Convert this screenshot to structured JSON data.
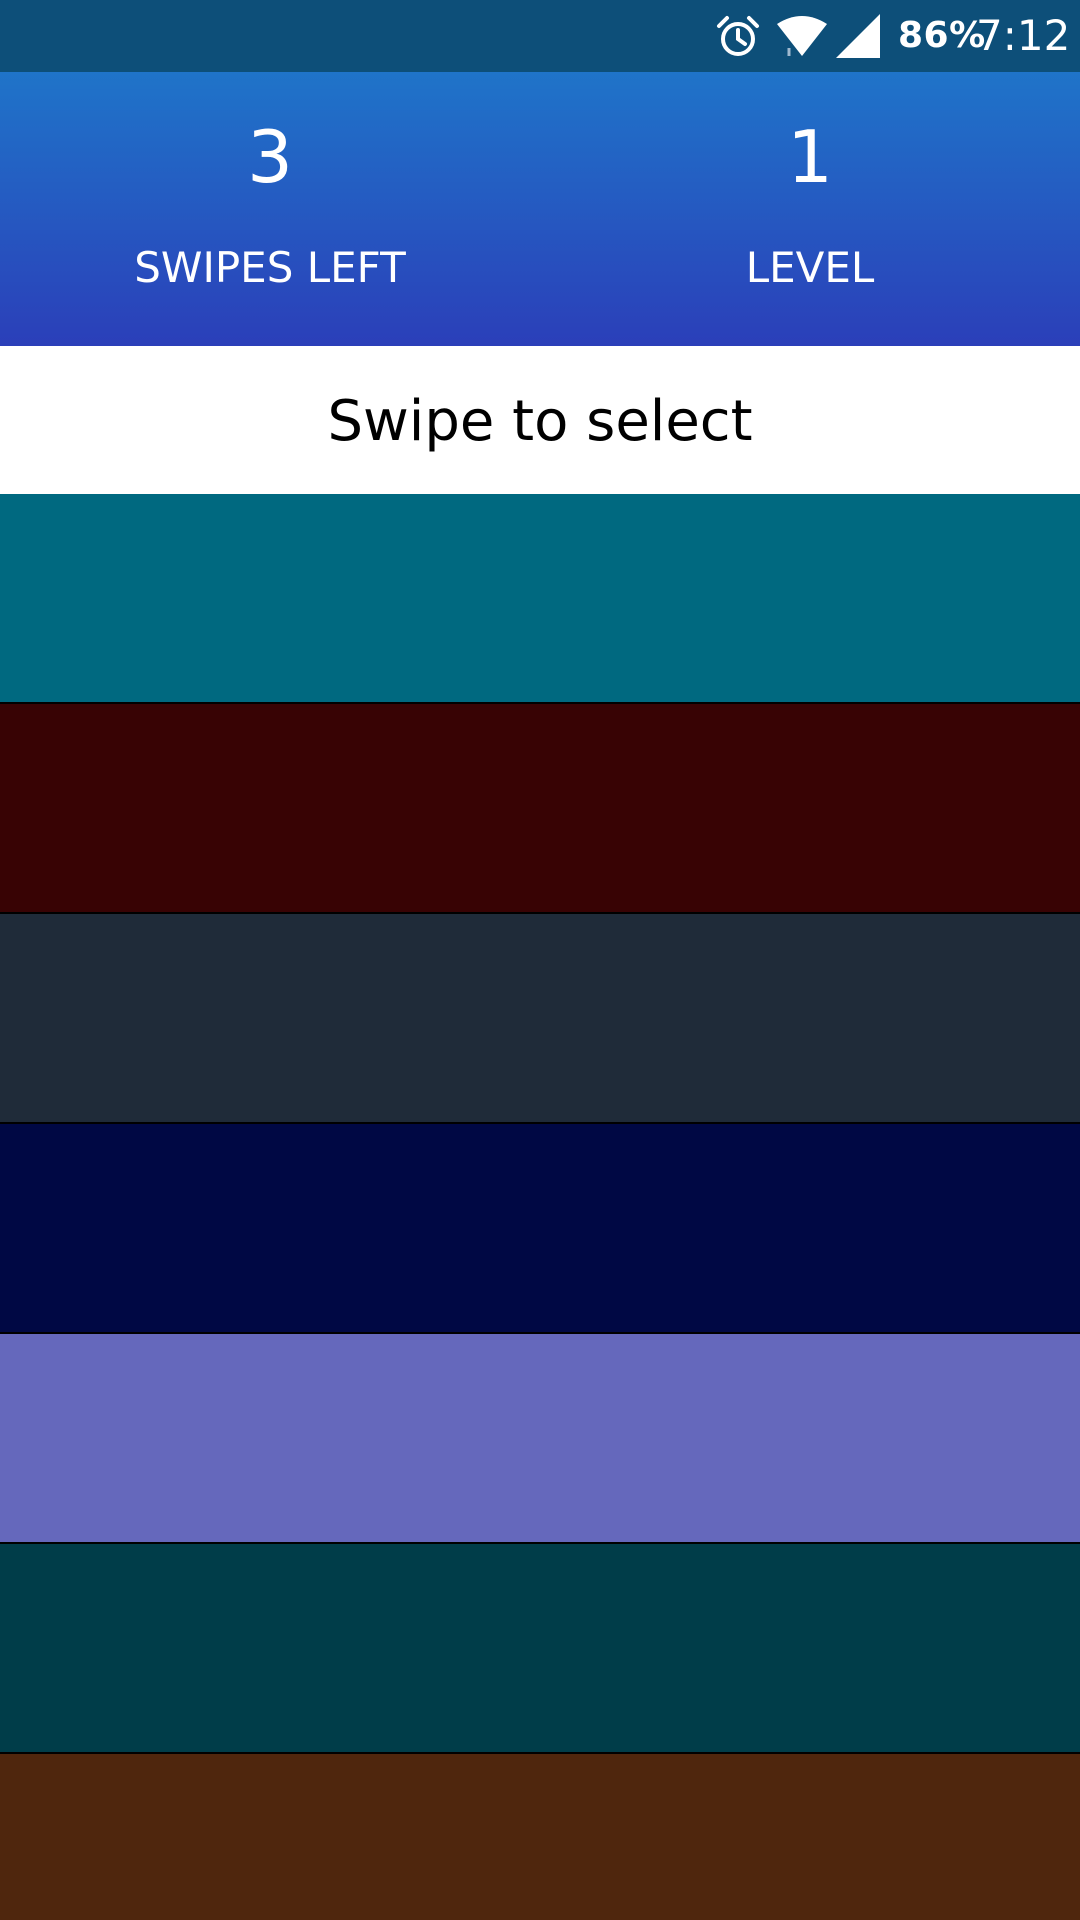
{
  "status_bar": {
    "alarm_icon": "alarm-clock-icon",
    "wifi_icon": "wifi-icon",
    "signal_icon": "cell-signal-icon",
    "battery": "86%",
    "time": "7:12"
  },
  "header": {
    "swipes_left_value": "3",
    "swipes_left_label": "SWIPES LEFT",
    "level_value": "1",
    "level_label": "LEVEL"
  },
  "instruction": {
    "text": "Swipe to select"
  },
  "strips": [
    {
      "color": "#006980"
    },
    {
      "color": "#380304"
    },
    {
      "color": "#1f2b39"
    },
    {
      "color": "#000844"
    },
    {
      "color": "#6568bc"
    },
    {
      "color": "#003d49"
    },
    {
      "color": "#4f260d"
    }
  ],
  "colors": {
    "status_bar": "#0d4f79",
    "header_top": "#1f74c9",
    "header_bottom": "#2b3fb9"
  }
}
